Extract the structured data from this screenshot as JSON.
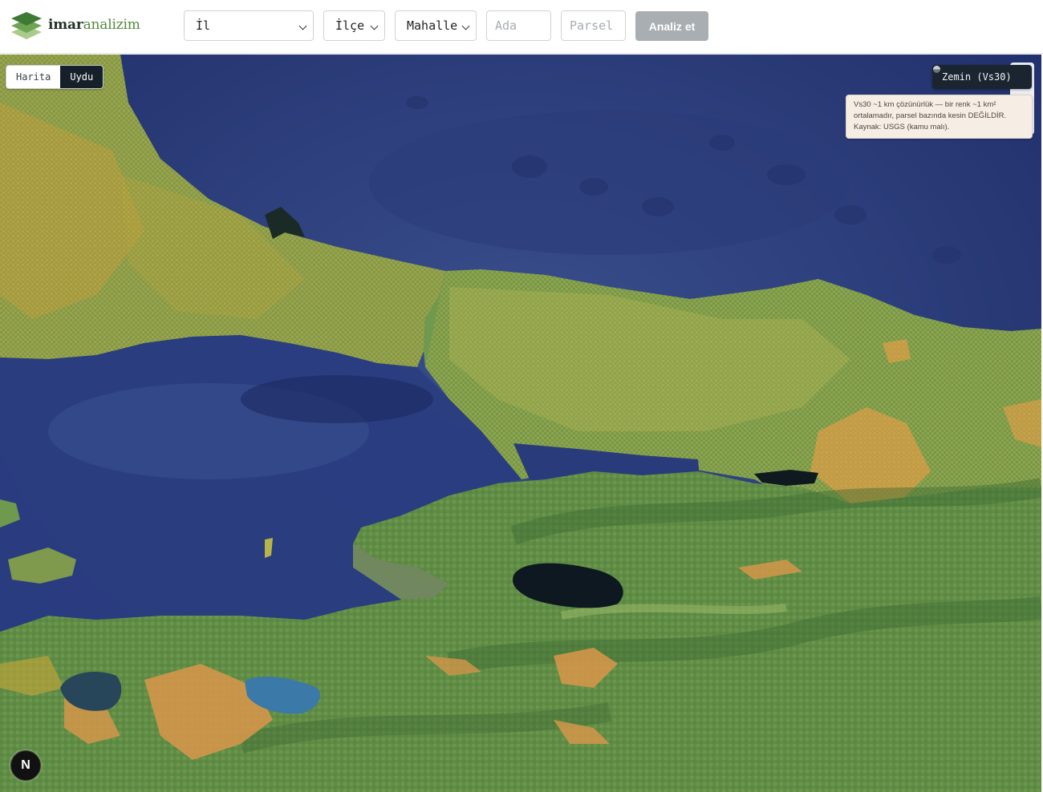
{
  "app": {
    "brand_part1": "imar",
    "brand_part2": "analizim"
  },
  "search": {
    "il": {
      "value": "İl"
    },
    "ilce": {
      "value": "İlçe"
    },
    "mahalle": {
      "value": "Mahalle"
    },
    "ada": {
      "placeholder": "Ada",
      "value": ""
    },
    "parsel": {
      "placeholder": "Parsel",
      "value": ""
    },
    "analyze_label": "Analiz et"
  },
  "map": {
    "basemap_toggle": {
      "options": [
        "Harita",
        "Uydu"
      ],
      "selected": "Uydu"
    },
    "layer_button": {
      "icon": "layer-icon",
      "label": "Zemin (Vs30)"
    },
    "notice": {
      "text": "Vs30 ~1 km çözünürlük — bir renk ~1 km² ortalamadır, parsel bazında kesin DEĞİLDİR. Kaynak: USGS (kamu malı)."
    },
    "dev_badge": {
      "icon": "nextjs-icon",
      "label": "N"
    }
  },
  "colors": {
    "primary_dark": "#1a2530",
    "brand_green": "#4e8a3a",
    "button_disabled": "#a9aeb3",
    "notice_bg": "#f6ede4"
  }
}
